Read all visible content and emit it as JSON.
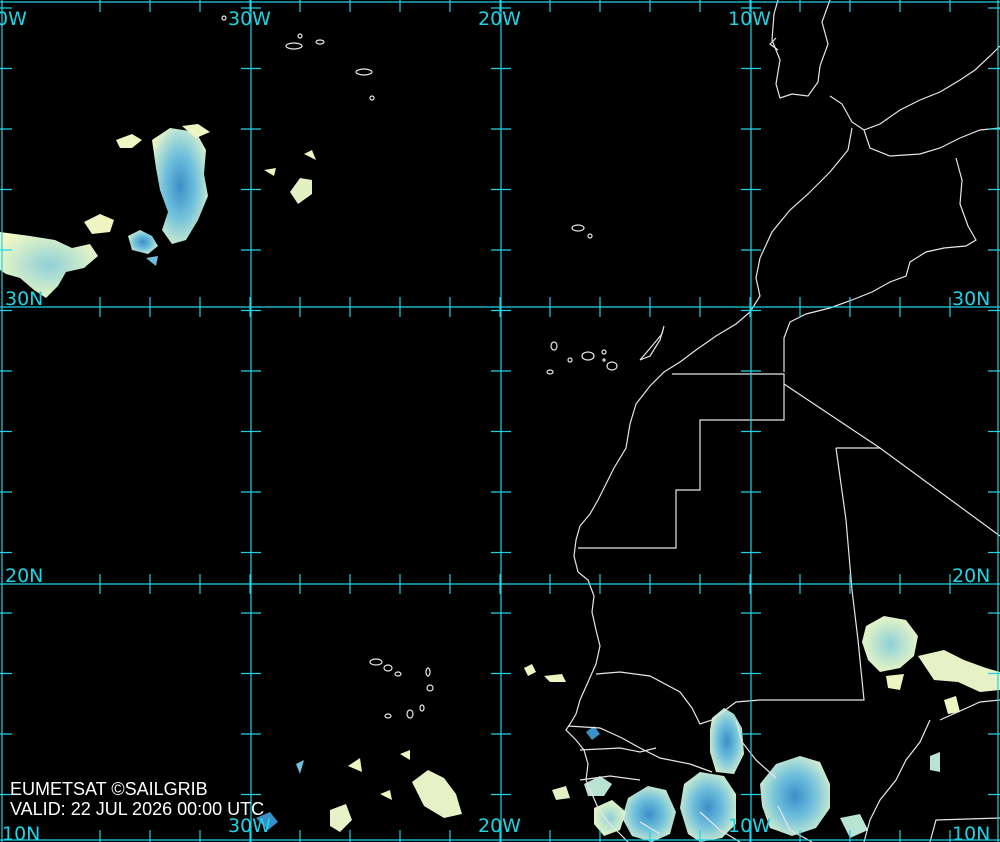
{
  "map": {
    "credit": "EUMETSAT ©SAILGRIB",
    "valid": "VALID:  22 JUL 2026 00:00 UTC",
    "grid_color": "#1fd3e6",
    "coast_color": "#e6e6e6",
    "cloud_palette": [
      "#f3f7c4",
      "#b9e3d2",
      "#6fbfdc",
      "#3a8fc8"
    ],
    "top_labels": [
      "0W",
      "30W",
      "20W",
      "10W"
    ],
    "bottom_labels": [
      "10N",
      "30W",
      "20W",
      "10W",
      "10N"
    ],
    "lat_labels_left": [
      "30N",
      "20N"
    ],
    "lat_labels_right": [
      "30N",
      "20N"
    ]
  }
}
